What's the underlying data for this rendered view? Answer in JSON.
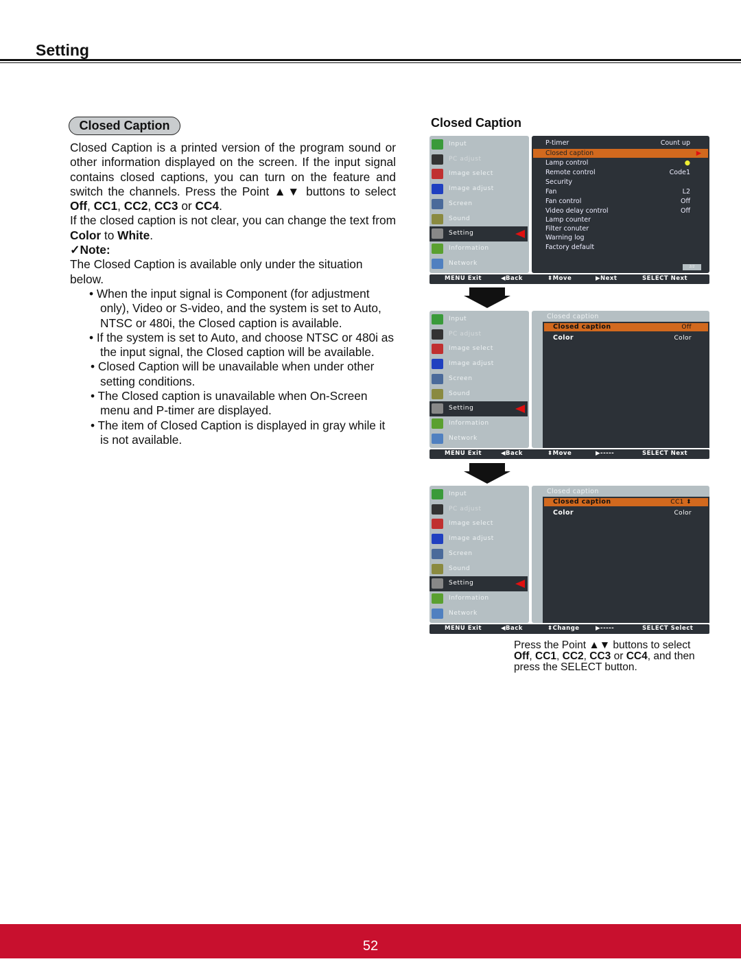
{
  "header": {
    "title": "Setting"
  },
  "section": {
    "pill": "Closed Caption",
    "intro_1": "Closed Caption is a printed version of the program sound or other information displayed on the screen. If the input signal contains closed captions, you can turn on the feature and switch the channels. Press the Point ▲▼ buttons to select ",
    "opts": [
      "Off",
      "CC1",
      "CC2",
      "CC3",
      "CC4"
    ],
    "intro_2": "If the closed caption is not clear, you can change the text from ",
    "color_word": "Color",
    "to": " to ",
    "white_word": "White",
    "note_label": "✓Note:",
    "note_text": "The Closed Caption is available only under the situation below.",
    "bullets": [
      "•  When the input signal is Component (for adjustment only),  Video or  S-video, and the system is set to Auto, NTSC or 480i, the Closed caption is available.",
      "•  If  the system is set to Auto, and choose NTSC or 480i as the input signal, the Closed caption will be available.",
      "• Closed Caption will be unavailable when under other setting conditions.",
      "• The Closed caption is unavailable when On-Screen menu and P-timer are displayed.",
      "• The item of Closed Caption is displayed in gray while it is not available."
    ]
  },
  "right_title": "Closed Caption",
  "menu_left": [
    {
      "label": "Input",
      "icon": "input-icon",
      "color": "#3a9a3a"
    },
    {
      "label": "PC adjust",
      "icon": "pc-adjust-icon",
      "color": "#333"
    },
    {
      "label": "Image select",
      "icon": "image-select-icon",
      "color": "#c03030"
    },
    {
      "label": "Image adjust",
      "icon": "image-adjust-icon",
      "color": "#2040c0"
    },
    {
      "label": "Screen",
      "icon": "screen-icon",
      "color": "#4a6a9a"
    },
    {
      "label": "Sound",
      "icon": "sound-icon",
      "color": "#8a8a40"
    },
    {
      "label": "Setting",
      "icon": "setting-icon",
      "color": "#888"
    },
    {
      "label": "Information",
      "icon": "information-icon",
      "color": "#5aa030"
    },
    {
      "label": "Network",
      "icon": "network-icon",
      "color": "#5080c0"
    }
  ],
  "menu1": {
    "items": [
      {
        "label": "P-timer",
        "value": "Count up"
      },
      {
        "label": "Closed caption",
        "value": "▶"
      },
      {
        "label": "Lamp control",
        "value": "●"
      },
      {
        "label": "Remote control",
        "value": "Code1"
      },
      {
        "label": "Security",
        "value": ""
      },
      {
        "label": "Fan",
        "value": "L2"
      },
      {
        "label": "Fan control",
        "value": "Off"
      },
      {
        "label": "Video delay control",
        "value": "Off"
      },
      {
        "label": "Lamp counter",
        "value": ""
      },
      {
        "label": "Filter conuter",
        "value": ""
      },
      {
        "label": "Warning log",
        "value": ""
      },
      {
        "label": "Factory default",
        "value": ""
      }
    ],
    "page": "2/2",
    "bar": [
      "MENU Exit",
      "◀Back",
      "⬍Move",
      "▶Next",
      "SELECT Next"
    ]
  },
  "menu2": {
    "title": "Closed caption",
    "items": [
      {
        "label": "Closed caption",
        "value": "Off"
      },
      {
        "label": "Color",
        "value": "Color"
      }
    ],
    "bar": [
      "MENU Exit",
      "◀Back",
      "⬍Move",
      "▶-----",
      "SELECT Next"
    ]
  },
  "menu3": {
    "title": "Closed caption",
    "items": [
      {
        "label": "Closed caption",
        "value": "CC1 ⬍"
      },
      {
        "label": "Color",
        "value": "Color"
      }
    ],
    "bar": [
      "MENU Exit",
      "◀Back",
      "⬍Change",
      "▶-----",
      "SELECT Select"
    ]
  },
  "caption": {
    "line1": "Press the Point ▲▼ buttons to select",
    "opts": [
      "Off",
      "CC1",
      "CC2",
      "CC3",
      "CC4"
    ],
    "line2_end": ", and then",
    "line3": "press the SELECT button."
  },
  "page_number": "52",
  "colors": {
    "footer": "#c8102e",
    "highlight": "#d2691e",
    "panel": "#2c3137"
  }
}
